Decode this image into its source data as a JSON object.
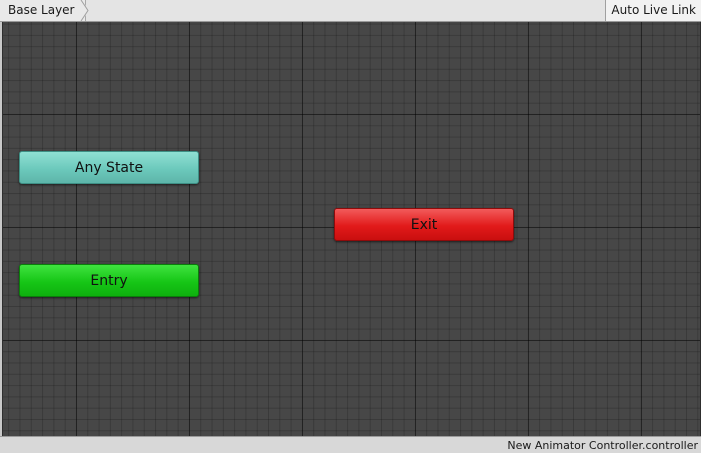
{
  "breadcrumb": {
    "layer_label": "Base Layer",
    "separator_icon": "chevron-right-icon"
  },
  "toolbar": {
    "live_link_label": "Auto Live Link"
  },
  "graph": {
    "nodes": {
      "any_state": {
        "label": "Any State",
        "color": "#6cc9bc"
      },
      "exit": {
        "label": "Exit",
        "color": "#e21a1a"
      },
      "entry": {
        "label": "Entry",
        "color": "#16c616"
      }
    },
    "background_color": "#474747"
  },
  "status": {
    "file_name": "New Animator Controller.controller"
  }
}
